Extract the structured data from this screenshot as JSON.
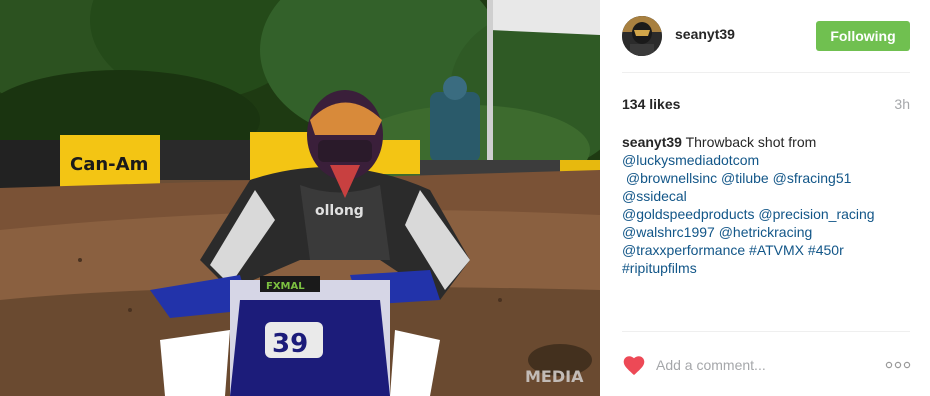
{
  "post": {
    "photo_watermark": "MEDIA",
    "photo_sponsor_text": "Can-Am"
  },
  "header": {
    "username": "seanyt39",
    "follow_label": "Following"
  },
  "stats": {
    "likes": "134 likes",
    "time": "3h"
  },
  "caption": {
    "user": "seanyt39",
    "lines": [
      [
        {
          "t": "text",
          "v": " Throwback shot from"
        }
      ],
      [
        {
          "t": "tag",
          "v": "@luckysmediadotcom"
        }
      ],
      [
        {
          "t": "text",
          "v": " "
        },
        {
          "t": "tag",
          "v": "@brownellsinc"
        },
        {
          "t": "text",
          "v": " "
        },
        {
          "t": "tag",
          "v": "@tilube"
        },
        {
          "t": "text",
          "v": " "
        },
        {
          "t": "tag",
          "v": "@sfracing51"
        }
      ],
      [
        {
          "t": "tag",
          "v": "@ssidecal"
        }
      ],
      [
        {
          "t": "tag",
          "v": "@goldspeedproducts"
        },
        {
          "t": "text",
          "v": " "
        },
        {
          "t": "tag",
          "v": "@precision_racing"
        }
      ],
      [
        {
          "t": "tag",
          "v": "@walshrc1997"
        },
        {
          "t": "text",
          "v": " "
        },
        {
          "t": "tag",
          "v": "@hetrickracing"
        }
      ],
      [
        {
          "t": "tag",
          "v": "@traxxperformance"
        },
        {
          "t": "text",
          "v": " "
        },
        {
          "t": "tag",
          "v": "#ATVMX"
        },
        {
          "t": "text",
          "v": " "
        },
        {
          "t": "tag",
          "v": "#450r"
        }
      ],
      [
        {
          "t": "tag",
          "v": "#ripitupfilms"
        }
      ]
    ]
  },
  "footer": {
    "comment_placeholder": "Add a comment...",
    "heart_icon": "heart-icon",
    "more_icon": "more-options-icon",
    "heart_color": "#ed4956"
  },
  "colors": {
    "follow_button": "#70c050",
    "link": "#125688",
    "muted": "#a5a7aa"
  }
}
